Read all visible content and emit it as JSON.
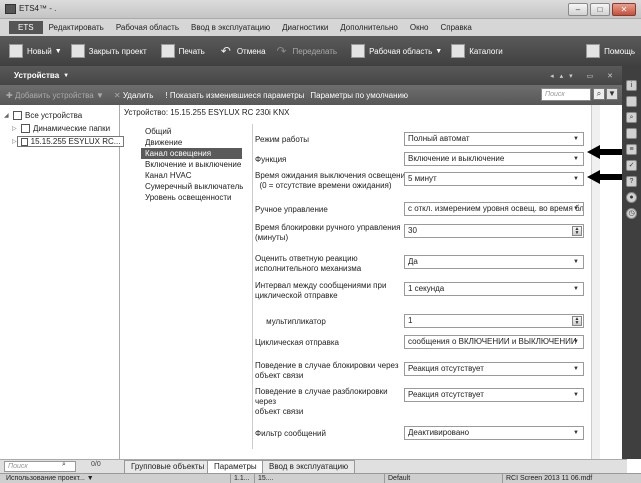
{
  "window": {
    "title": "ETS4™ - .",
    "min": "–",
    "max": "□",
    "close": "✕"
  },
  "menu": {
    "ets": "ETS",
    "items": [
      "Редактировать",
      "Рабочая область",
      "Ввод в эксплуатацию",
      "Диагностики",
      "Дополнительно",
      "Окно",
      "Справка"
    ]
  },
  "toolbar": {
    "new_label": "Новый",
    "close_label": "Закрыть проект",
    "print_label": "Печать",
    "undo_label": "Отмена",
    "redo_label": "Переделать",
    "workspace_label": "Рабочая область",
    "catalogs_label": "Каталоги",
    "help_label": "Помощь"
  },
  "panel": {
    "title": "Устройства",
    "add_devices": "Добавить устройства",
    "delete": "Удалить",
    "show_changed": "Показать изменившиеся параметры",
    "defaults": "Параметры по умолчанию",
    "search_placeholder": "Поиск"
  },
  "tree": {
    "all": "Все устройства",
    "dynamic": "Динамические папки",
    "device": "15.15.255 ESYLUX RC..."
  },
  "device_header": "Устройство: 15.15.255 ESYLUX RC 230i KNX",
  "nav": [
    "Общий",
    "Движение",
    "Канал освещения",
    "Включение и выключение",
    "Канал HVAC",
    "Сумеречный выключатель",
    "Уровень освещенности"
  ],
  "params": [
    {
      "label": "Режим работы",
      "value": "Полный автомат",
      "ctrl": "dropdown"
    },
    {
      "label": "Функция",
      "value": "Включение и выключение",
      "ctrl": "dropdown"
    },
    {
      "label": "Время ожидания выключения освещения\n  (0 = отсутствие времени ожидания)",
      "value": "5 минут",
      "ctrl": "dropdown"
    },
    {
      "label": "Ручное управление",
      "value": "с откл. измерением уровня освещ. во время бл",
      "ctrl": "dropdown"
    },
    {
      "label": "Время блокировки ручного управления\n(минуты)",
      "value": "30",
      "ctrl": "spin"
    },
    {
      "label": "Оценить ответную реакцию\nисполнительного механизма",
      "value": "Да",
      "ctrl": "dropdown"
    },
    {
      "label": "Интервал между сообщениями при\nциклической отправке",
      "value": "1 секунда",
      "ctrl": "dropdown"
    },
    {
      "label": "     мультипликатор",
      "value": "1",
      "ctrl": "spin"
    },
    {
      "label": "Циклическая отправка",
      "value": "сообщения о ВКЛЮЧЕНИИ и ВЫКЛЮЧЕНИИ",
      "ctrl": "dropdown"
    },
    {
      "label": "Поведение в случае блокировки через\nобъект связи",
      "value": "Реакция отсутствует",
      "ctrl": "dropdown"
    },
    {
      "label": "Поведение в случае разблокировки\nчерез\nобъект связи",
      "value": "Реакция отсутствует",
      "ctrl": "dropdown"
    },
    {
      "label": "Фильтр сообщений",
      "value": "Деактивировано",
      "ctrl": "dropdown"
    }
  ],
  "bottom": {
    "search_placeholder": "Поиск",
    "count": "0/0"
  },
  "tabs": [
    "Групповые объекты",
    "Параметры",
    "Ввод в эксплуатацию"
  ],
  "status": {
    "project": "Использование проект...",
    "c1": "1.1...",
    "c2": "15....",
    "c3": "Default",
    "c4": "RCI Screen 2013 11 06.mdf"
  }
}
